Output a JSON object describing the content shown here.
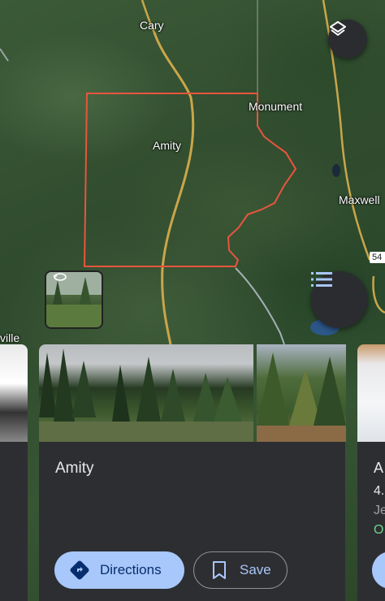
{
  "map": {
    "labels": {
      "cary": "Cary",
      "monument": "Monument",
      "amity": "Amity",
      "maxwell": "Maxwell",
      "ville": "ville"
    },
    "route_badge": "54"
  },
  "colors": {
    "boundary": "#e8553f",
    "road": "#c9a64a",
    "button_primary": "#a8c7fa",
    "card_bg": "#2d2e32"
  },
  "icons": {
    "layers": "layers-icon",
    "list": "list-icon",
    "street_view_rotate": "rotate-360-icon",
    "directions": "directions-diamond-icon",
    "save": "bookmark-icon"
  },
  "place_card": {
    "title": "Amity",
    "directions_label": "Directions",
    "save_label": "Save"
  },
  "peek_card": {
    "line1": "A",
    "line2": "4.",
    "line3": "Je",
    "line4": "O"
  }
}
